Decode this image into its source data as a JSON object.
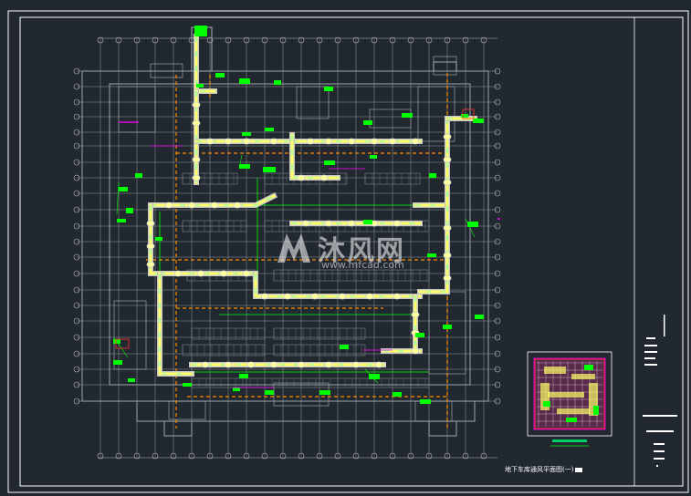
{
  "drawing": {
    "caption": "地下车库通风平面图(一)",
    "watermark_text": "沐风网",
    "watermark_url": "www.mfcad.com",
    "background": "#212830",
    "colors": {
      "frame": "#ffffff",
      "grid": "#c0c0c0",
      "walls": "#8a8f96",
      "duct_fill": "#ffff66",
      "duct_outline": "#c8c8c8",
      "orange_dashed": "#ff8c00",
      "green_annotation": "#00ff00",
      "cyan": "#00ffff",
      "magenta": "#ff00ff",
      "red": "#ff3030",
      "blue": "#3355ff"
    }
  }
}
